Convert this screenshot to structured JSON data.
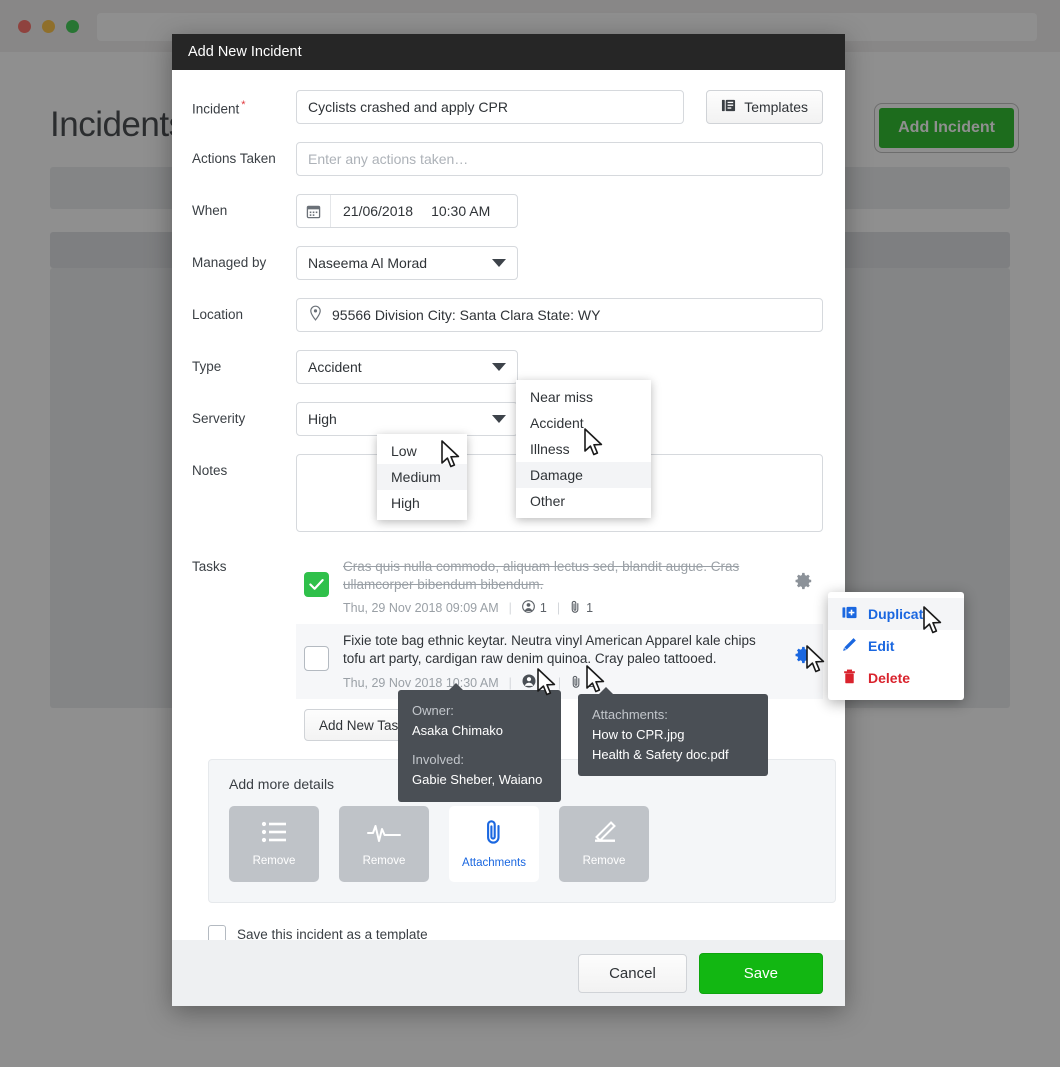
{
  "window": {
    "traffic_lights": [
      "close",
      "minimize",
      "maximize"
    ],
    "address_bar_value": ""
  },
  "background_page": {
    "title": "Incidents",
    "add_incident_button": "Add Incident"
  },
  "modal": {
    "title": "Add New Incident",
    "fields": {
      "incident": {
        "label": "Incident",
        "required_marker": "*",
        "value": "Cyclists crashed and apply CPR",
        "templates_button": "Templates"
      },
      "actions_taken": {
        "label": "Actions Taken",
        "value": "",
        "placeholder": "Enter any actions taken…"
      },
      "when": {
        "label": "When",
        "date": "21/06/2018",
        "time": "10:30 AM"
      },
      "managed_by": {
        "label": "Managed by",
        "value": "Naseema Al Morad"
      },
      "location": {
        "label": "Location",
        "value": "95566 Division City: Santa Clara State: WY"
      },
      "type": {
        "label": "Type",
        "value": "Accident",
        "options": [
          "Near miss",
          "Accident",
          "Illness",
          "Damage",
          "Other"
        ],
        "highlighted": "Damage"
      },
      "severity": {
        "label": "Serverity",
        "value": "High",
        "options": [
          "Low",
          "Medium",
          "High"
        ],
        "highlighted": "Medium"
      },
      "notes": {
        "label": "Notes",
        "value": ""
      }
    },
    "tasks": {
      "label": "Tasks",
      "items": [
        {
          "checked": true,
          "text": "Cras quis nulla commodo, aliquam lectus sed, blandit augue. Cras ullamcorper bibendum bibendum.",
          "timestamp": "Thu, 29 Nov 2018 09:09 AM",
          "people_count": "1",
          "attachment_count": "1"
        },
        {
          "checked": false,
          "text": "Fixie tote bag ethnic keytar. Neutra vinyl American Apparel kale chips tofu art party, cardigan raw denim quinoa. Cray paleo tattooed.",
          "timestamp": "Thu, 29 Nov 2018 10:30 AM",
          "people_count": "3",
          "attachment_count": "2"
        }
      ],
      "add_task_button": "Add New Task"
    },
    "context_menu": {
      "items": [
        "Duplicate",
        "Edit",
        "Delete"
      ],
      "highlighted": "Duplicate"
    },
    "tooltips": {
      "owner": {
        "owner_label": "Owner:",
        "owner_name": "Asaka Chimako",
        "involved_label": "Involved:",
        "involved_names": "Gabie Sheber, Waiano"
      },
      "attachments": {
        "label": "Attachments:",
        "files": [
          "How to CPR.jpg",
          "Health & Safety doc.pdf"
        ]
      }
    },
    "add_more_details": {
      "heading": "Add more details",
      "tiles": [
        {
          "icon": "list-icon",
          "label": "Remove",
          "active": false
        },
        {
          "icon": "pulse-icon",
          "label": "Remove",
          "active": false
        },
        {
          "icon": "paperclip-icon",
          "label": "Attachments",
          "active": true
        },
        {
          "icon": "pencil-icon",
          "label": "Remove",
          "active": false
        }
      ]
    },
    "save_as_template": {
      "label": "Save this incident as a template",
      "checked": false
    },
    "footer": {
      "cancel": "Cancel",
      "save": "Save"
    }
  },
  "colors": {
    "header_bg": "#262626",
    "primary_green": "#12b712",
    "link_blue": "#1a67e0",
    "danger_red": "#d9232d",
    "checkbox_green": "#2fc04a"
  }
}
